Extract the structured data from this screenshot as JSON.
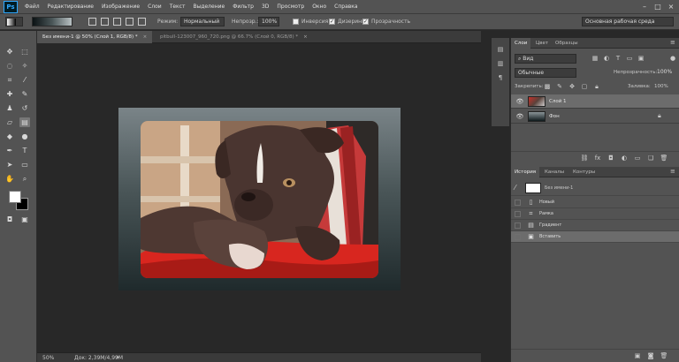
{
  "app": {
    "logo": "Ps"
  },
  "menu": [
    "Файл",
    "Редактирование",
    "Изображение",
    "Слои",
    "Текст",
    "Выделение",
    "Фильтр",
    "3D",
    "Просмотр",
    "Окно",
    "Справка"
  ],
  "window_controls": {
    "minimize": "–",
    "maximize": "□",
    "close": "×"
  },
  "options": {
    "mode_label": "Режим:",
    "mode_value": "Нормальный",
    "opacity_label": "Непрозр.:",
    "opacity_value": "100%",
    "reverse_label": "Инверсия",
    "reverse_checked": false,
    "dither_label": "Дизеринг",
    "dither_checked": true,
    "transparency_label": "Прозрачность",
    "transparency_checked": true,
    "workspace": "Основная рабочая среда"
  },
  "tabs": [
    {
      "label": "Без имени-1 @ 50% (Слой 1, RGB/8) *",
      "close": "×",
      "active": true
    },
    {
      "label": "pitbull-123007_960_720.png @ 66.7% (Слой 0, RGB/8) *",
      "close": "×",
      "active": false
    }
  ],
  "status": {
    "zoom": "50%",
    "doc_size": "Док: 2,39M/4,99M"
  },
  "layers_panel": {
    "tabs": [
      "Слои",
      "Цвет",
      "Образцы"
    ],
    "kind_filter": "Вид",
    "blend_mode": "Обычные",
    "opacity_label": "Непрозрачность:",
    "opacity_value": "100%",
    "lock_label": "Закрепить:",
    "fill_label": "Заливка:",
    "fill_value": "100%",
    "layers": [
      {
        "name": "Слой 1",
        "selected": true,
        "visible": true
      },
      {
        "name": "Фон",
        "selected": false,
        "visible": true,
        "locked": true
      }
    ]
  },
  "history_panel": {
    "tabs": [
      "История",
      "Каналы",
      "Контуры"
    ],
    "snapshot": "Без имени-1",
    "items": [
      {
        "name": "Новый",
        "icon": "new-doc-icon",
        "selected": false
      },
      {
        "name": "Рамка",
        "icon": "crop-icon",
        "selected": false
      },
      {
        "name": "Градиент",
        "icon": "gradient-icon",
        "selected": false
      },
      {
        "name": "Вставить",
        "icon": "paste-icon",
        "selected": true
      }
    ]
  },
  "colors": {
    "chrome": "#535353",
    "canvas_bg": "#282828",
    "accent_logo": "#31a8ff",
    "pillow_red": "#d8261f",
    "dog_brown": "#4a3530"
  }
}
